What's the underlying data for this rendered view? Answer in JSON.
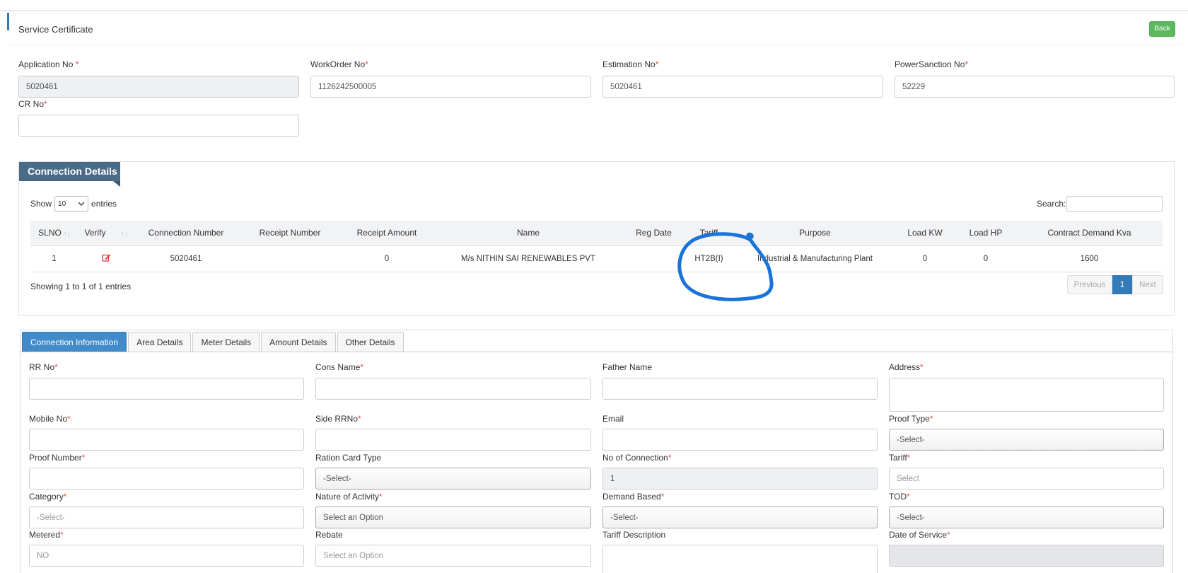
{
  "header": {
    "title": "Service Certificate",
    "back_label": "Back"
  },
  "form": {
    "application_no": {
      "label": "Application No",
      "value": "5020461"
    },
    "workorder_no": {
      "label": "WorkOrder No",
      "value": "1126242500005"
    },
    "estimation_no": {
      "label": "Estimation No",
      "value": "5020461"
    },
    "powersanction_no": {
      "label": "PowerSanction No",
      "value": "52229"
    },
    "cr_no": {
      "label": "CR No",
      "value": ""
    }
  },
  "connection": {
    "panel_title": "Connection Details",
    "show_label": "Show",
    "entries_label": "entries",
    "page_length": "10",
    "search_label": "Search:",
    "columns": [
      "SLNO",
      "Verify",
      "Connection Number",
      "Receipt Number",
      "Receipt Amount",
      "Name",
      "Reg Date",
      "Tariff",
      "Purpose",
      "Load KW",
      "Load HP",
      "Contract Demand Kva"
    ],
    "rows": [
      {
        "slno": "1",
        "connection_number": "5020461",
        "receipt_number": "",
        "receipt_amount": "0",
        "name": "M/s NITHIN SAI RENEWABLES PVT",
        "reg_date": "",
        "tariff": "HT2B(I)",
        "purpose": "Industrial & Manufacturing Plant",
        "load_kw": "0",
        "load_hp": "0",
        "contract_demand_kva": "1600"
      }
    ],
    "info": "Showing 1 to 1 of 1 entries",
    "pager": {
      "previous": "Previous",
      "current": "1",
      "next": "Next"
    }
  },
  "tabs": [
    {
      "label": "Connection Information",
      "active": true
    },
    {
      "label": "Area Details",
      "active": false
    },
    {
      "label": "Meter Details",
      "active": false
    },
    {
      "label": "Amount Details",
      "active": false
    },
    {
      "label": "Other Details",
      "active": false
    }
  ],
  "info_form": {
    "rr_no": {
      "label": "RR No",
      "value": ""
    },
    "cons_name": {
      "label": "Cons Name",
      "value": ""
    },
    "father_name": {
      "label": "Father Name",
      "value": ""
    },
    "address": {
      "label": "Address",
      "value": ""
    },
    "mobile_no": {
      "label": "Mobile No",
      "value": ""
    },
    "side_rrno": {
      "label": "Side RRNo",
      "value": ""
    },
    "email": {
      "label": "Email",
      "value": ""
    },
    "proof_type": {
      "label": "Proof Type",
      "value": "-Select-"
    },
    "proof_number": {
      "label": "Proof Number",
      "value": ""
    },
    "ration_card_type": {
      "label": "Ration Card Type",
      "value": "-Select-"
    },
    "no_of_connection": {
      "label": "No of Connection",
      "value": "1"
    },
    "tariff": {
      "label": "Tariff",
      "placeholder": "Select"
    },
    "category": {
      "label": "Category",
      "value": "-Select-"
    },
    "nature_of_activity": {
      "label": "Nature of Activity",
      "value": "Select an Option"
    },
    "demand_based": {
      "label": "Demand Based",
      "value": "-Select-"
    },
    "tod": {
      "label": "TOD",
      "value": "-Select-"
    },
    "metered": {
      "label": "Metered",
      "value": "NO"
    },
    "rebate": {
      "label": "Rebate",
      "placeholder": "Select an Option"
    },
    "tariff_description": {
      "label": "Tariff Description",
      "value": ""
    },
    "date_of_service": {
      "label": "Date of Service",
      "value": ""
    }
  },
  "colors": {
    "primary": "#337ab7",
    "success": "#5cb85c",
    "panel_tag": "#4a6b88",
    "required": "#d9534f",
    "annotation": "#1a73d9"
  }
}
